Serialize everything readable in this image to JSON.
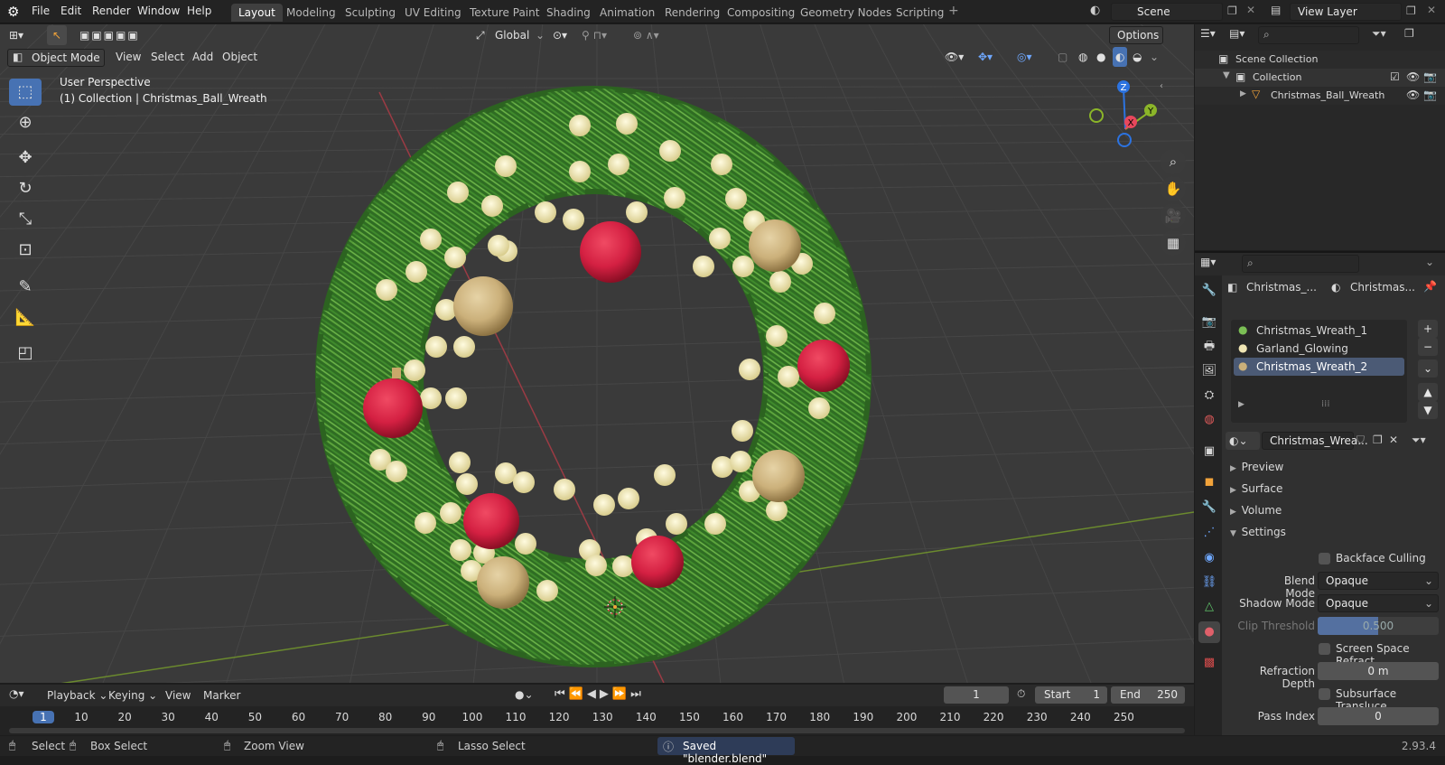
{
  "topbar": {
    "menus": [
      "File",
      "Edit",
      "Render",
      "Window",
      "Help"
    ],
    "workspaces": [
      "Layout",
      "Modeling",
      "Sculpting",
      "UV Editing",
      "Texture Paint",
      "Shading",
      "Animation",
      "Rendering",
      "Compositing",
      "Geometry Nodes",
      "Scripting"
    ],
    "active_workspace": "Layout",
    "scene": "Scene",
    "view_layer": "View Layer"
  },
  "viewport": {
    "transform_orientation": "Global",
    "options_label": "Options",
    "mode": "Object Mode",
    "header_menus": [
      "View",
      "Select",
      "Add",
      "Object"
    ],
    "overlay_line1": "User Perspective",
    "overlay_line2": "(1) Collection | Christmas_Ball_Wreath",
    "gizmo": {
      "x": "X",
      "y": "Y",
      "z": "Z"
    },
    "colors": {
      "x_axis": "#e8475c",
      "y_axis": "#8bb529",
      "z_axis": "#2c73e0",
      "wreath": "#3f8a2c",
      "ball_red": "#d42042",
      "ball_gold": "#cbb07a",
      "bulb": "#f0e6b4"
    }
  },
  "outliner": {
    "search_placeholder": "",
    "scene_collection": "Scene Collection",
    "collection": "Collection",
    "object": "Christmas_Ball_Wreath"
  },
  "properties": {
    "breadcrumb_object": "Christmas_...",
    "breadcrumb_material": "Christmas...",
    "materials": [
      "Christmas_Wreath_1",
      "Garland_Glowing",
      "Christmas_Wreath_2"
    ],
    "selected_material": "Christmas_Wreath_2",
    "material_field": "Christmas_Wrea...",
    "panels": {
      "preview": "Preview",
      "surface": "Surface",
      "volume": "Volume",
      "settings": "Settings"
    },
    "settings": {
      "backface_culling": "Backface Culling",
      "blend_mode_label": "Blend Mode",
      "blend_mode": "Opaque",
      "shadow_mode_label": "Shadow Mode",
      "shadow_mode": "Opaque",
      "clip_threshold_label": "Clip Threshold",
      "clip_threshold": "0.500",
      "ssr_label": "Screen Space Refract...",
      "refraction_depth_label": "Refraction Depth",
      "refraction_depth": "0 m",
      "sss_label": "Subsurface Translucе...",
      "pass_index_label": "Pass Index",
      "pass_index": "0"
    }
  },
  "timeline": {
    "menus": [
      "Playback",
      "Keying",
      "View",
      "Marker"
    ],
    "current_frame": "1",
    "start_label": "Start",
    "start": "1",
    "end_label": "End",
    "end": "250",
    "ticks": [
      "1",
      "10",
      "20",
      "30",
      "40",
      "50",
      "60",
      "70",
      "80",
      "90",
      "100",
      "110",
      "120",
      "130",
      "140",
      "150",
      "160",
      "170",
      "180",
      "190",
      "200",
      "210",
      "220",
      "230",
      "240",
      "250"
    ]
  },
  "statusbar": {
    "select": "Select",
    "box_select": "Box Select",
    "zoom_view": "Zoom View",
    "lasso_select": "Lasso Select",
    "message": "Saved \"blender.blend\"",
    "version": "2.93.4"
  }
}
